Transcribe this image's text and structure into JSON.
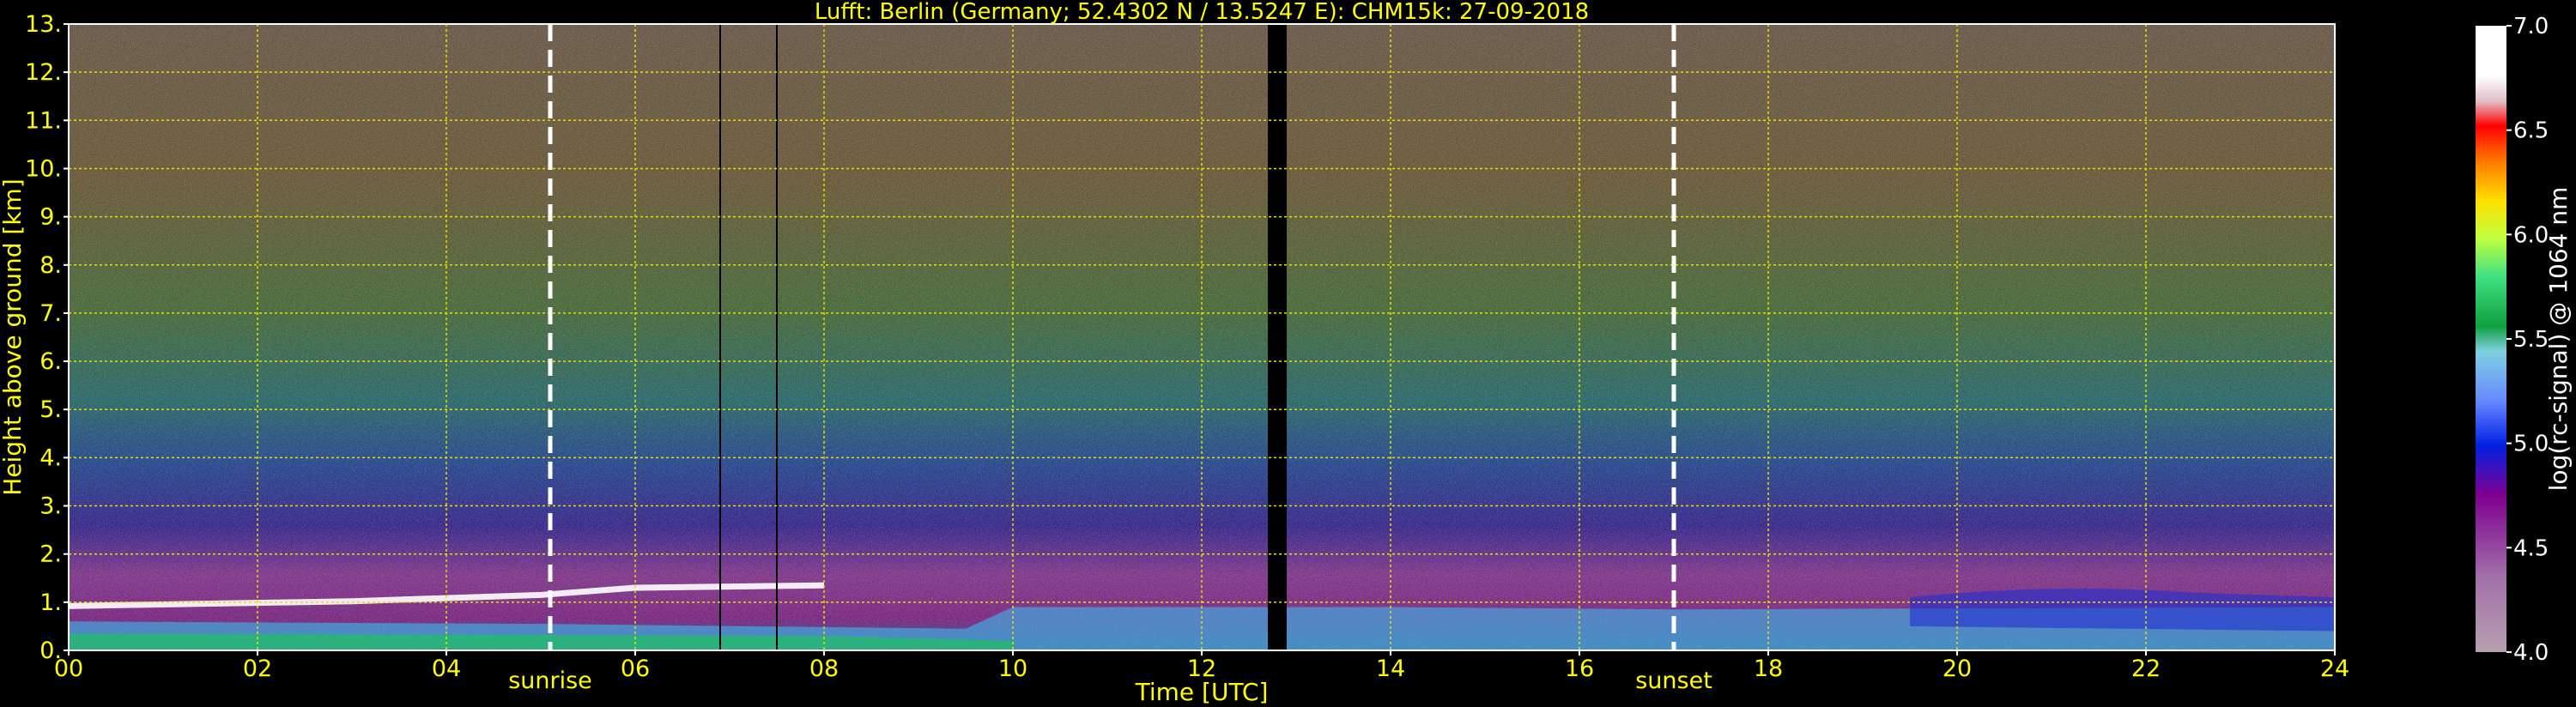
{
  "chart_data": {
    "type": "heatmap",
    "title": "Lufft: Berlin (Germany; 52.4302 N / 13.5247 E):    CHM15k: 27-09-2018",
    "xlabel": "Time [UTC]",
    "ylabel": "Height above ground [km]",
    "xlim": [
      0,
      24
    ],
    "ylim": [
      0,
      13
    ],
    "x_ticks": [
      "00",
      "02",
      "04",
      "06",
      "08",
      "10",
      "12",
      "14",
      "16",
      "18",
      "20",
      "22",
      "24"
    ],
    "y_ticks": [
      "0.",
      "1.",
      "2.",
      "3.",
      "4.",
      "5.",
      "6.",
      "7.",
      "8.",
      "9.",
      "10.",
      "11.",
      "12.",
      "13."
    ],
    "grid": true,
    "annotations": [
      {
        "text": "sunrise",
        "x": 5.1
      },
      {
        "text": "sunset",
        "x": 17.0
      }
    ],
    "colorbar": {
      "label": "log(rc-signal) @ 1064 nm",
      "range": [
        4.0,
        7.0
      ],
      "ticks": [
        "4.0",
        "4.5",
        "5.0",
        "5.5",
        "6.0",
        "6.5",
        "7.0"
      ]
    }
  }
}
